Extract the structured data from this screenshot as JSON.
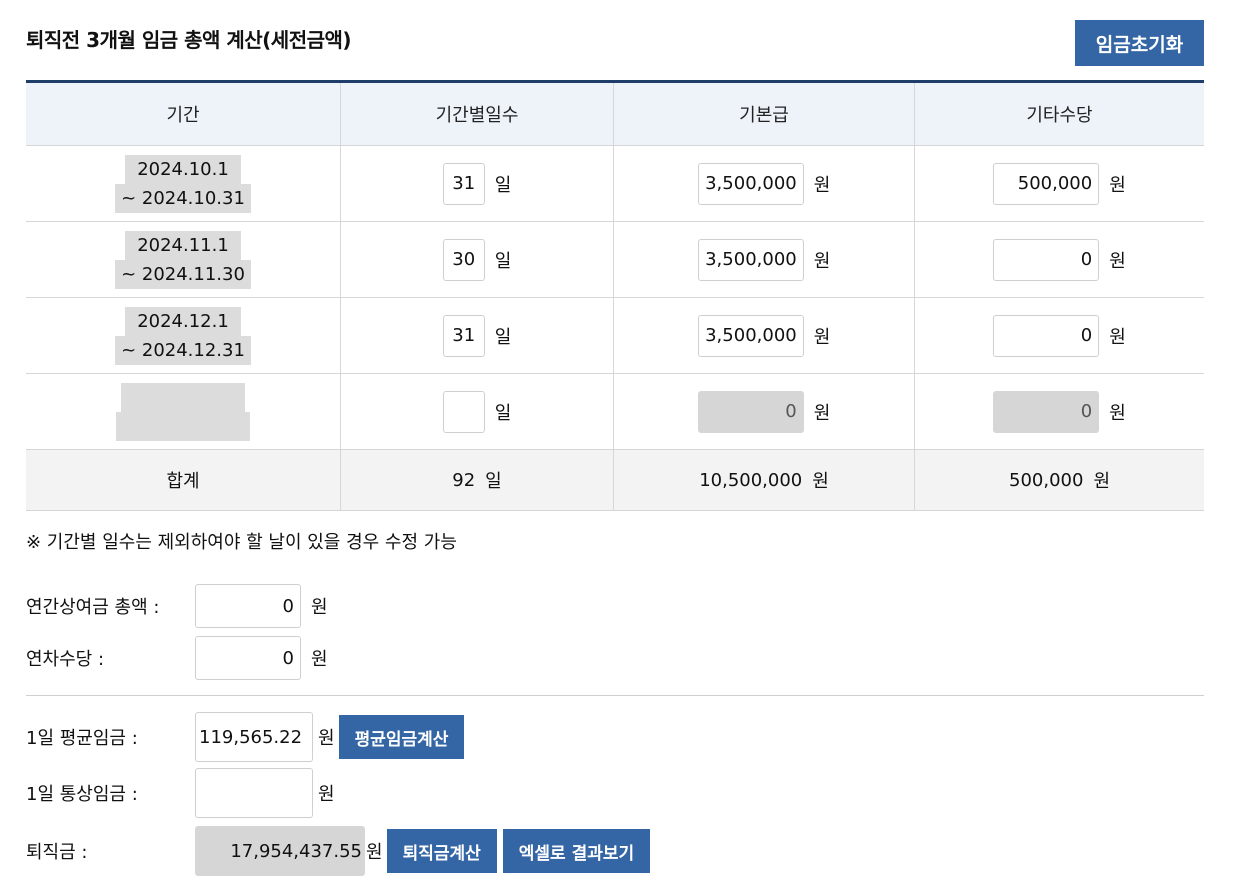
{
  "title": "퇴직전 3개월 임금 총액 계산(세전금액)",
  "reset_button": "임금초기화",
  "table": {
    "headers": [
      "기간",
      "기간별일수",
      "기본급",
      "기타수당"
    ],
    "rows": [
      {
        "start": "2024.10.1",
        "end": "~ 2024.10.31",
        "days": "31",
        "base": "3,500,000",
        "other": "500,000"
      },
      {
        "start": "2024.11.1",
        "end": "~ 2024.11.30",
        "days": "30",
        "base": "3,500,000",
        "other": "0"
      },
      {
        "start": "2024.12.1",
        "end": "~ 2024.12.31",
        "days": "31",
        "base": "3,500,000",
        "other": "0"
      },
      {
        "start": "",
        "end": "",
        "days": "",
        "base": "0",
        "other": "0"
      }
    ],
    "total": {
      "label": "합계",
      "days": "92",
      "base": "10,500,000",
      "other": "500,000"
    },
    "unit_day": "일",
    "unit_won": "원"
  },
  "note": "※ 기간별 일수는 제외하여야 할 날이 있을 경우 수정 가능",
  "bonus": {
    "label": "연간상여금 총액 :",
    "value": "0",
    "unit": "원"
  },
  "annual_leave": {
    "label": "연차수당 :",
    "value": "0",
    "unit": "원"
  },
  "avg_wage": {
    "label": "1일 평균임금 :",
    "value": "119,565.22",
    "unit": "원",
    "button": "평균임금계산"
  },
  "ordinary_wage": {
    "label": "1일 통상임금 :",
    "value": "",
    "unit": "원"
  },
  "severance": {
    "label": "퇴직금 :",
    "value": "17,954,437.55",
    "unit": "원",
    "button": "퇴직금계산",
    "excel_button": "엑셀로 결과보기"
  }
}
